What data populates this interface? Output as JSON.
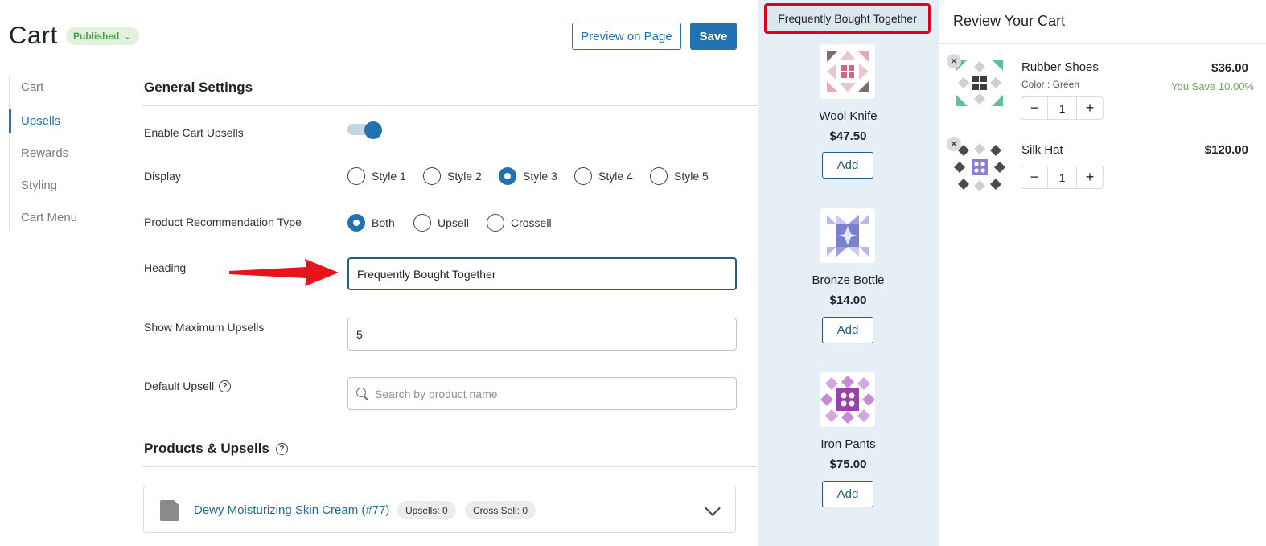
{
  "header": {
    "title": "Cart",
    "status": "Published",
    "preview_label": "Preview on Page",
    "save_label": "Save"
  },
  "sidebar": {
    "items": [
      {
        "label": "Cart",
        "active": false
      },
      {
        "label": "Upsells",
        "active": true
      },
      {
        "label": "Rewards",
        "active": false
      },
      {
        "label": "Styling",
        "active": false
      },
      {
        "label": "Cart Menu",
        "active": false
      }
    ]
  },
  "general": {
    "title": "General Settings",
    "enable_label": "Enable Cart Upsells",
    "enable_on": true,
    "display_label": "Display",
    "display_options": [
      "Style 1",
      "Style 2",
      "Style 3",
      "Style 4",
      "Style 5"
    ],
    "display_selected": "Style 3",
    "rec_label": "Product Recommendation Type",
    "rec_options": [
      "Both",
      "Upsell",
      "Crossell"
    ],
    "rec_selected": "Both",
    "heading_label": "Heading",
    "heading_value": "Frequently Bought Together",
    "max_label": "Show Maximum Upsells",
    "max_value": "5",
    "default_label": "Default Upsell",
    "default_placeholder": "Search by product name"
  },
  "products": {
    "title": "Products & Upsells",
    "item": {
      "name": "Dewy Moisturizing Skin Cream (#77)",
      "upsells": "Upsells: 0",
      "cross_sell": "Cross Sell: 0"
    }
  },
  "upsell_preview": {
    "heading": "Frequently Bought Together",
    "add_label": "Add",
    "items": [
      {
        "name": "Wool Knife",
        "price": "$47.50",
        "color": "#c96a82"
      },
      {
        "name": "Bronze Bottle",
        "price": "$14.00",
        "color": "#7b7fd0"
      },
      {
        "name": "Iron Pants",
        "price": "$75.00",
        "color": "#9c3fb0"
      }
    ]
  },
  "cart": {
    "title": "Review Your Cart",
    "items": [
      {
        "name": "Rubber Shoes",
        "variant": "Color : Green",
        "price": "$36.00",
        "save": "You Save 10.00%",
        "qty": "1"
      },
      {
        "name": "Silk Hat",
        "variant": "",
        "price": "$120.00",
        "save": "",
        "qty": "1"
      }
    ]
  },
  "colors": {
    "accent": "#2271b1",
    "highlight_border": "#e0001b",
    "published_bg": "#e2f1de",
    "save_green": "#6da65d"
  }
}
